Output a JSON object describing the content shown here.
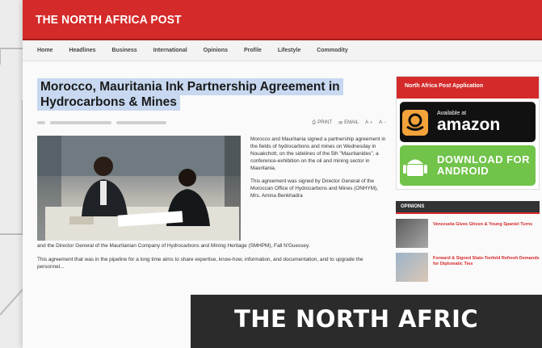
{
  "site": {
    "brand": "THE NORTH AFRICA POST"
  },
  "nav": [
    "Home",
    "Headlines",
    "Business",
    "International",
    "Opinions",
    "Profile",
    "Lifestyle",
    "Commodity"
  ],
  "article": {
    "title": "Morocco, Mauritania Ink Partnership Agreement in Hydrocarbons & Mines",
    "tools": {
      "print": "PRINT",
      "email": "EMAIL"
    },
    "side_paragraphs": [
      "Morocco and Mauritania signed a partnership agreement in the fields of hydrocarbons and mines on Wednesday in Nouakchott, on the sidelines of the 5th \"Mauritanides\", a conference-exhibition on the oil and mining sector in Mauritania.",
      "This agreement was signed by Director General of the Moroccan Office of Hydrocarbons and Mines (ONHYM), Mrs. Amina Benkhadra"
    ],
    "continued": "and the Director General of the Mauritanian Company of Hydrocarbons and Mining Heritage (SMHPM), Fall N'Guessey.",
    "paragraph2": "This agreement that was in the pipeline for a long time aims to share expertise, know-how, information, and documentation, and to upgrade the personnel..."
  },
  "sidebar": {
    "app_heading": "North Africa Post Application",
    "amazon_small": "Available at",
    "amazon_big": "amazon",
    "android_line1": "DOWNLOAD FOR",
    "android_line2": "ANDROID",
    "opinions_heading": "OPINIONS",
    "opinions": [
      "Venezuela Gives Ghosn & Young Spaniel Turns",
      "Forward & Signed State-Tenfold Refresh Demands for Diplomatic Ties"
    ]
  },
  "overlay": {
    "text": "THE NORTH AFRIC"
  },
  "colors": {
    "brand_red": "#d42a2a",
    "headline_highlight": "#c7d8f0",
    "android_green": "#71c34a"
  }
}
